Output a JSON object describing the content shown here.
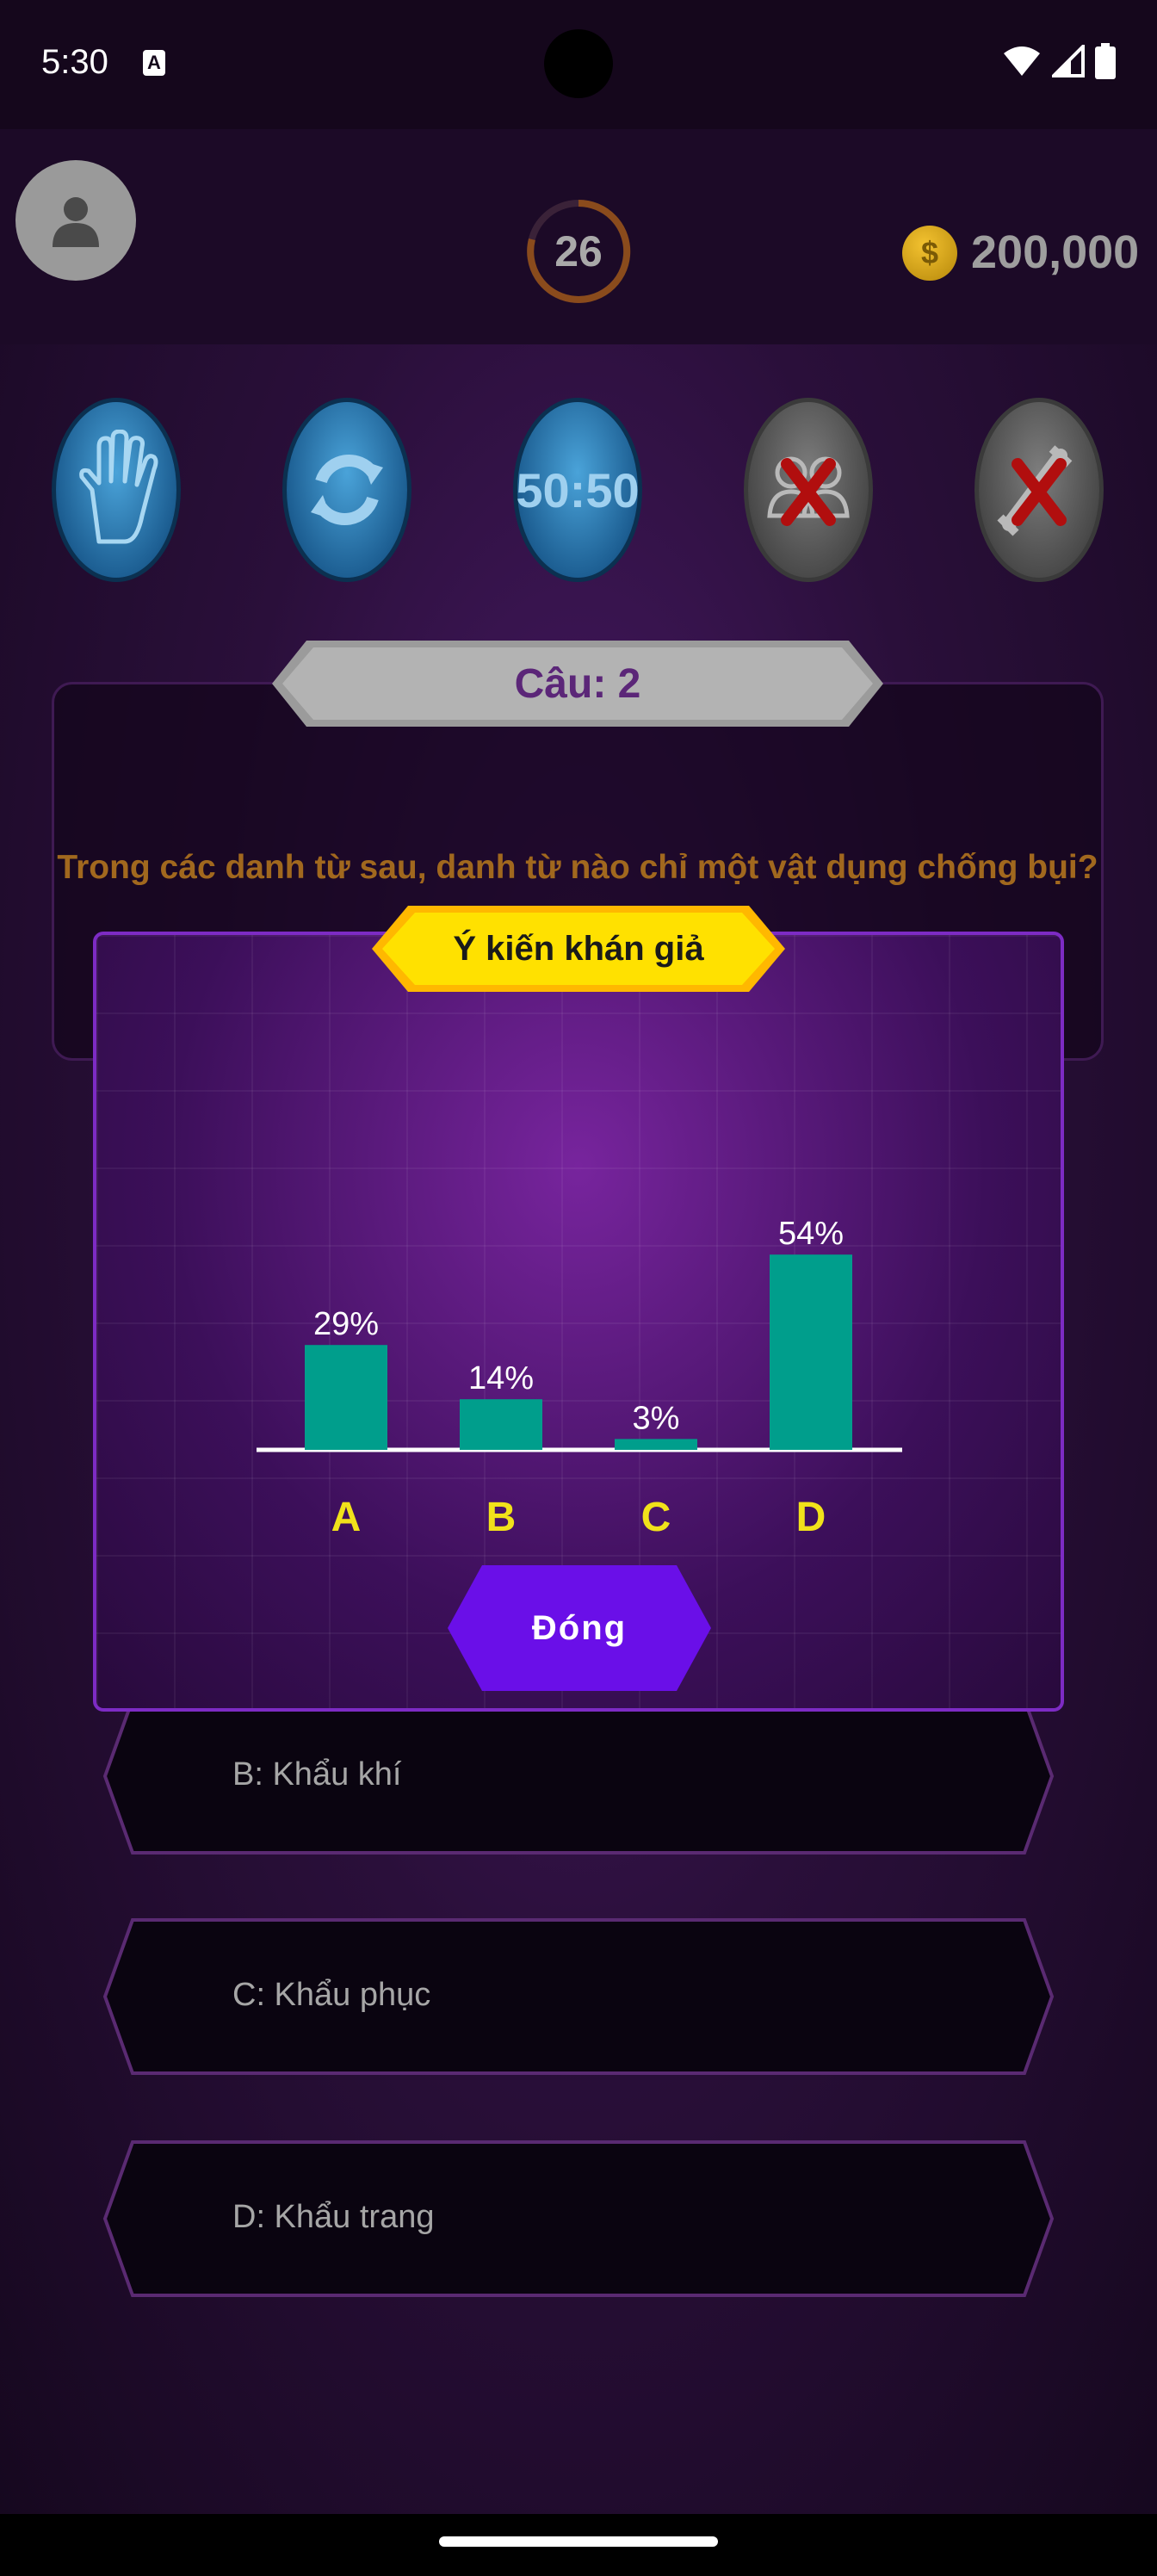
{
  "status_bar": {
    "time": "5:30",
    "notification_icon": "A"
  },
  "header": {
    "timer": "26",
    "coin_symbol": "$",
    "score": "200,000"
  },
  "lifelines": [
    {
      "name": "stop-hand-icon",
      "state": "available"
    },
    {
      "name": "swap-question-icon",
      "state": "available"
    },
    {
      "name": "fifty-fifty",
      "label": "50:50",
      "state": "available"
    },
    {
      "name": "audience-icon",
      "state": "used"
    },
    {
      "name": "phone-icon",
      "state": "used"
    }
  ],
  "question": {
    "number_label": "Câu: 2",
    "text": "Trong các danh từ sau, danh từ nào chỉ một vật dụng chống bụi?"
  },
  "answers": [
    {
      "label": "B: Khẩu khí"
    },
    {
      "label": "C: Khẩu phục"
    },
    {
      "label": "D: Khẩu trang"
    }
  ],
  "popup": {
    "title": "Ý kiến khán giả",
    "close_label": "Đóng"
  },
  "chart_data": {
    "type": "bar",
    "categories": [
      "A",
      "B",
      "C",
      "D"
    ],
    "values": [
      29,
      14,
      3,
      54
    ],
    "value_labels": [
      "29%",
      "14%",
      "3%",
      "54%"
    ],
    "ylim": [
      0,
      100
    ],
    "bar_color": "#009e8c",
    "category_color": "#f1e21a"
  },
  "colors": {
    "accent_purple": "#6a0fe8",
    "popup_border": "#7d2bc4",
    "title_yellow": "#ffe100"
  }
}
